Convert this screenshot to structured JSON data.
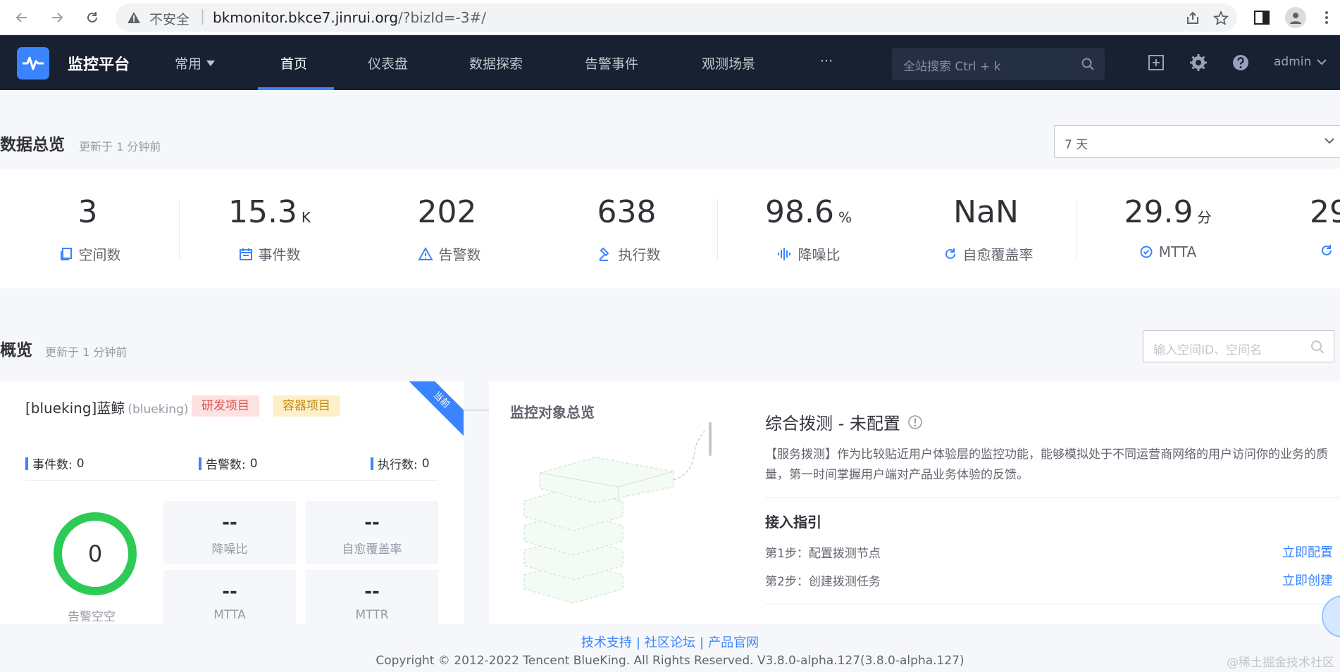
{
  "browser": {
    "security_label": "不安全",
    "url_host": "bkmonitor.bkce7.jinrui.org",
    "url_path": "/?bizId=-3#/"
  },
  "header": {
    "app_title": "监控平台",
    "common_menu": "常用",
    "nav": [
      "首页",
      "仪表盘",
      "数据探索",
      "告警事件",
      "观测场景",
      "···"
    ],
    "active_nav": "首页",
    "search_placeholder": "全站搜索 Ctrl + k",
    "user": "admin"
  },
  "data_overview": {
    "title": "数据总览",
    "updated": "更新于 1 分钟前",
    "time_range": "7 天",
    "stats": [
      {
        "value": "3",
        "unit": "",
        "label": "空间数",
        "icon": "copy-icon"
      },
      {
        "value": "15.3",
        "unit": "K",
        "label": "事件数",
        "icon": "calendar-icon"
      },
      {
        "value": "202",
        "unit": "",
        "label": "告警数",
        "icon": "warning-icon"
      },
      {
        "value": "638",
        "unit": "",
        "label": "执行数",
        "icon": "gavel-icon"
      },
      {
        "value": "98.6",
        "unit": "%",
        "label": "降噪比",
        "icon": "waveform-icon"
      },
      {
        "value": "NaN",
        "unit": "",
        "label": "自愈覆盖率",
        "icon": "refresh-icon"
      },
      {
        "value": "29.9",
        "unit": "分",
        "label": "MTTA",
        "icon": "clock-check-icon"
      },
      {
        "value": "29",
        "unit": "",
        "label": "",
        "icon": "refresh-icon"
      }
    ]
  },
  "overview": {
    "title": "概览",
    "updated": "更新于 1 分钟前",
    "search_placeholder": "输入空间ID、空间名",
    "space_card": {
      "name": "[blueking]蓝鲸",
      "code": "(blueking)",
      "tags": [
        "研发项目",
        "容器项目"
      ],
      "ribbon": "当前",
      "counts": [
        {
          "label": "事件数:",
          "value": "0"
        },
        {
          "label": "告警数:",
          "value": "0"
        },
        {
          "label": "执行数:",
          "value": "0"
        }
      ],
      "ring_value": "0",
      "ring_label": "告警空空",
      "metrics": [
        {
          "value": "--",
          "label": "降噪比"
        },
        {
          "value": "--",
          "label": "自愈覆盖率"
        },
        {
          "value": "--",
          "label": "MTTA"
        },
        {
          "value": "--",
          "label": "MTTR"
        }
      ]
    },
    "monitor_card": {
      "title": "监控对象总览"
    },
    "probe_card": {
      "title": "综合拨测 - 未配置",
      "description": "【服务拨测】作为比较贴近用户体验层的监控功能，能够模拟处于不同运营商网络的用户访问你的业务的质量，第一时间掌握用户端对产品业务体验的反馈。",
      "guide_title": "接入指引",
      "steps": [
        {
          "text": "第1步：配置拨测节点",
          "link": "立即配置"
        },
        {
          "text": "第2步：创建拨测任务",
          "link": "立即创建"
        }
      ]
    }
  },
  "footer": {
    "links": [
      "技术支持",
      "社区论坛",
      "产品官网"
    ],
    "separator": "|",
    "copyright": "Copyright © 2012-2022 Tencent BlueKing. All Rights Reserved. V3.8.0-alpha.127(3.8.0-alpha.127)",
    "watermark": "@稀土掘金技术社区"
  },
  "colors": {
    "header_bg": "#182132",
    "accent": "#3a84ff",
    "success": "#2dcb56"
  }
}
